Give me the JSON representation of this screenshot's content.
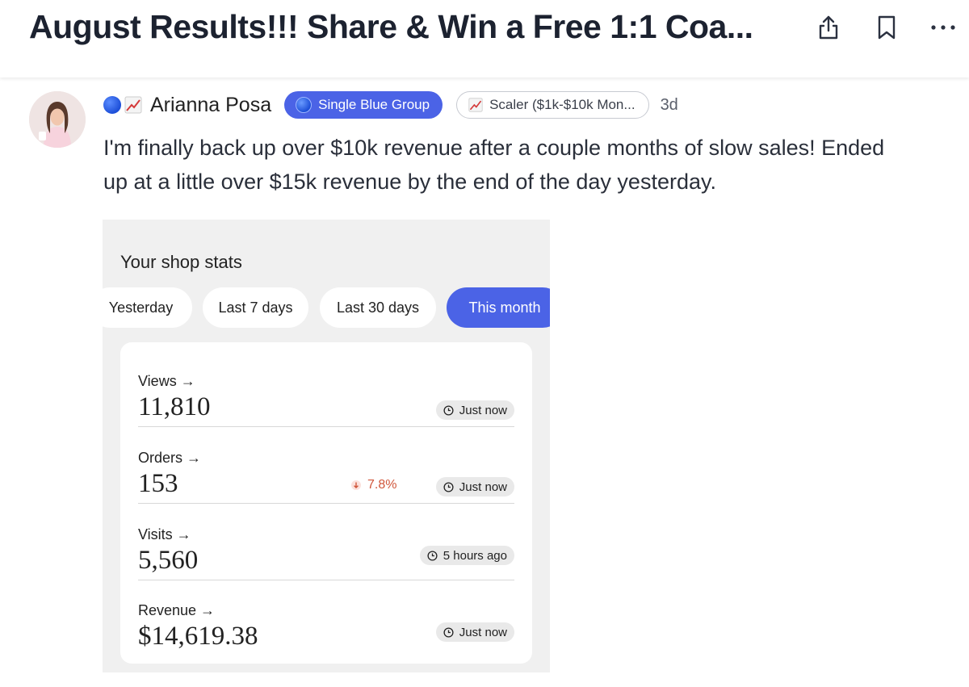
{
  "header": {
    "title": "August Results!!! Share & Win a Free 1:1 Coa...",
    "share_icon": "share-icon",
    "bookmark_icon": "bookmark-icon",
    "more_icon": "more-icon"
  },
  "post": {
    "author": "Arianna Posa",
    "group_badge": "Single Blue Group",
    "level_badge": "Scaler ($1k-$10k Mon...",
    "age": "3d",
    "text_line1": "I'm finally back up over $10k revenue after a couple months of slow sales! Ended",
    "text_line2": "up at a little over $15k revenue by the end of the day yesterday."
  },
  "screenshot": {
    "heading": "Your shop stats",
    "tabs": [
      {
        "label": "Yesterday",
        "active": false
      },
      {
        "label": "Last 7 days",
        "active": false
      },
      {
        "label": "Last 30 days",
        "active": false
      },
      {
        "label": "This month",
        "active": true
      }
    ],
    "stats": [
      {
        "label": "Views →",
        "value": "11,810",
        "updated": "Just now"
      },
      {
        "label": "Orders →",
        "value": "153",
        "change": "7.8%",
        "updated": "Just now"
      },
      {
        "label": "Visits →",
        "value": "5,560",
        "updated": "5 hours ago"
      },
      {
        "label": "Revenue →",
        "value": "$14,619.38",
        "updated": "Just now"
      }
    ]
  },
  "colors": {
    "accent": "#4b63e6",
    "negative": "#d0563b"
  }
}
